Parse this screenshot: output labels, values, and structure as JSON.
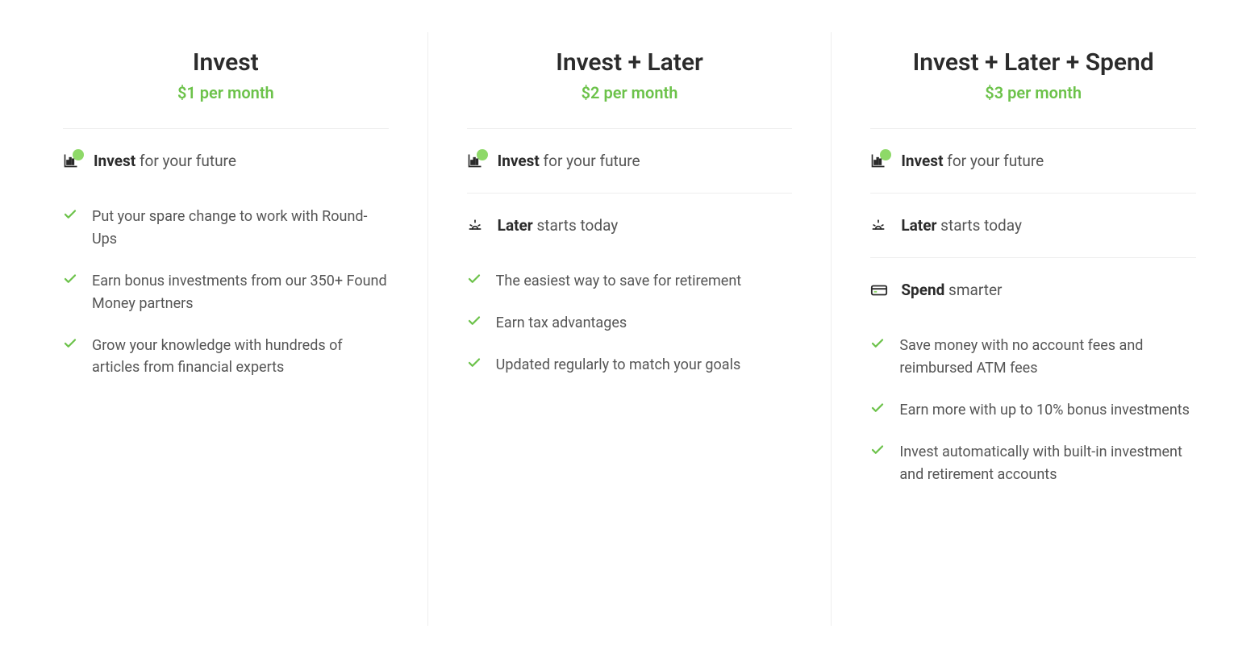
{
  "plans": [
    {
      "title": "Invest",
      "price": "$1 per month",
      "sections": [
        {
          "icon": "chart",
          "label_bold": "Invest",
          "label_rest": " for your future",
          "bullets": [
            "Put your spare change to work with Round-Ups",
            "Earn bonus investments from our 350+ Found Money partners",
            "Grow your knowledge with hundreds of articles from financial experts"
          ]
        }
      ]
    },
    {
      "title": "Invest + Later",
      "price": "$2 per month",
      "sections": [
        {
          "icon": "chart",
          "label_bold": "Invest",
          "label_rest": " for your future",
          "bullets": []
        },
        {
          "icon": "sunrise",
          "label_bold": "Later",
          "label_rest": " starts today",
          "bullets": [
            "The easiest way to save for retirement",
            "Earn tax advantages",
            "Updated regularly to match your goals"
          ]
        }
      ]
    },
    {
      "title": "Invest + Later + Spend",
      "price": "$3 per month",
      "sections": [
        {
          "icon": "chart",
          "label_bold": "Invest",
          "label_rest": " for your future",
          "bullets": []
        },
        {
          "icon": "sunrise",
          "label_bold": "Later",
          "label_rest": " starts today",
          "bullets": []
        },
        {
          "icon": "card",
          "label_bold": "Spend",
          "label_rest": " smarter",
          "bullets": [
            "Save money with no account fees and reimbursed ATM fees",
            "Earn more with up to 10% bonus investments",
            "Invest automatically with built-in investment and retirement accounts"
          ]
        }
      ]
    }
  ]
}
